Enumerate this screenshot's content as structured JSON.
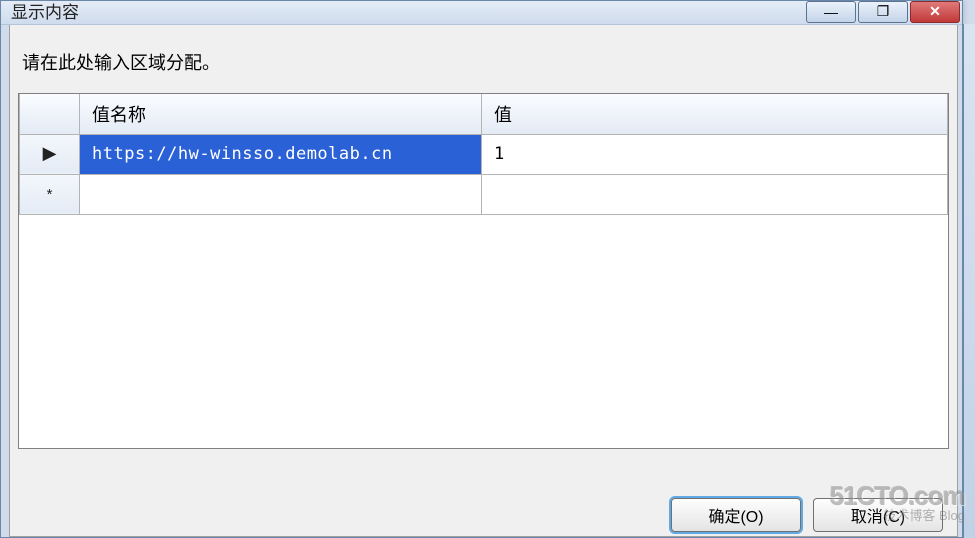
{
  "window": {
    "title": "显示内容",
    "controls": {
      "min": "—",
      "max": "❐",
      "close": "✕"
    }
  },
  "instruction": "请在此处输入区域分配。",
  "grid": {
    "headers": {
      "name": "值名称",
      "value": "值"
    },
    "rows": [
      {
        "marker": "▶",
        "name": "https://hw-winsso.demolab.cn",
        "value": "1",
        "selected": true
      },
      {
        "marker": "*",
        "name": "",
        "value": "",
        "selected": false
      }
    ]
  },
  "buttons": {
    "ok": "确定(O)",
    "cancel": "取消(C)"
  },
  "watermark": {
    "big": "51CTO.com",
    "small": "技术博客  Blog"
  }
}
